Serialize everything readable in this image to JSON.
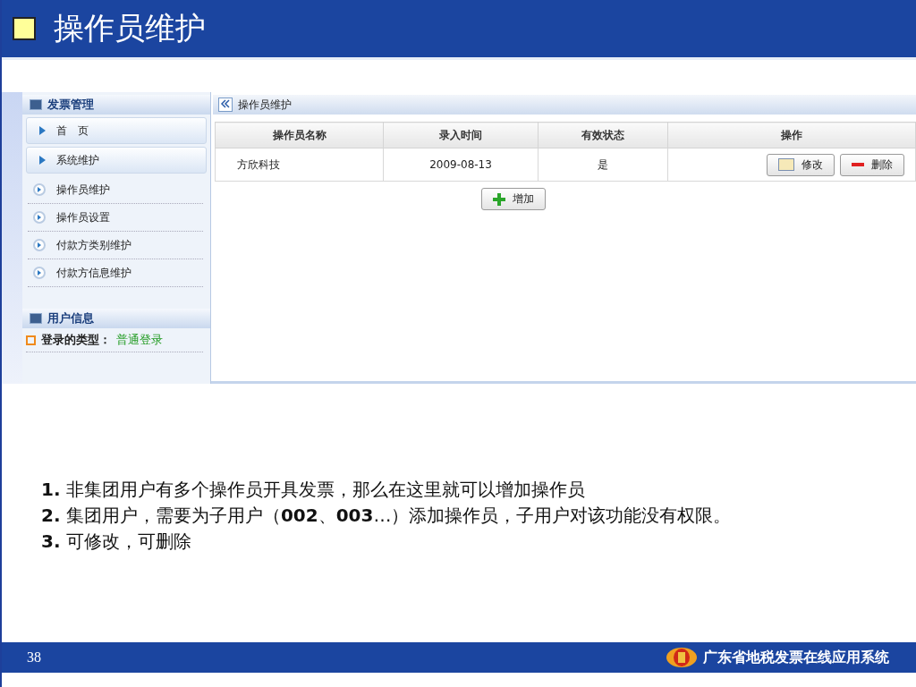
{
  "slide": {
    "title": "操作员维护",
    "page_number": "38",
    "footer_title": "广东省地税发票在线应用系统"
  },
  "sidebar": {
    "sections": [
      {
        "title": "发票管理",
        "items": [
          {
            "label": "首　页",
            "kind": "main"
          },
          {
            "label": "系统维护",
            "kind": "main"
          },
          {
            "label": "操作员维护",
            "kind": "sub"
          },
          {
            "label": "操作员设置",
            "kind": "sub"
          },
          {
            "label": "付款方类别维护",
            "kind": "sub"
          },
          {
            "label": "付款方信息维护",
            "kind": "sub"
          }
        ]
      },
      {
        "title": "用户信息",
        "info": {
          "label": "登录的类型：",
          "value": "普通登录"
        }
      }
    ]
  },
  "main": {
    "breadcrumb": "操作员维护",
    "table": {
      "columns": [
        "操作员名称",
        "录入时间",
        "有效状态",
        "操作"
      ],
      "rows": [
        {
          "name": "方欣科技",
          "date": "2009-08-13",
          "status": "是",
          "actions": [
            {
              "label": "修改",
              "kind": "edit"
            },
            {
              "label": "删除",
              "kind": "delete"
            }
          ]
        }
      ]
    },
    "add_button": "增加"
  },
  "notes": [
    "**1.** 非集团用户有多个操作员开具发票，那么在这里就可以增加操作员",
    "**2.** 集团用户，需要为子用户（**002**、**003**…）添加操作员，子用户对该功能没有权限。",
    "**3.** 可修改，可删除"
  ]
}
